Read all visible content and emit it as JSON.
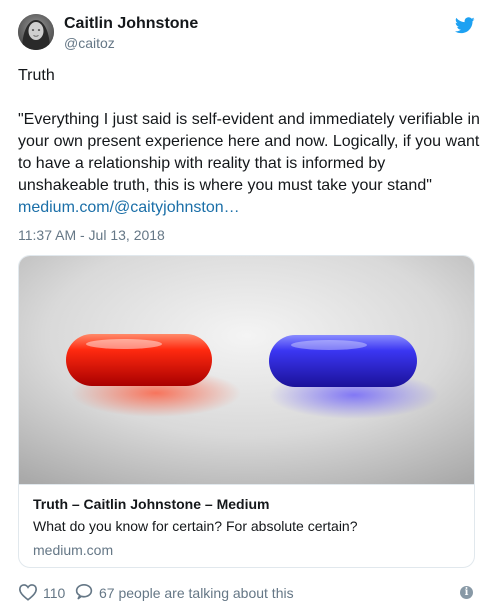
{
  "author": {
    "name": "Caitlin Johnstone",
    "handle": "@caitoz"
  },
  "tweet": {
    "text": "Truth\n\n\"Everything I just said is self-evident and immediately verifiable in your own present experience here and now. Logically, if you want to have a relationship with reality that is informed by unshakeable truth, this is where you must take your stand\"",
    "link": "medium.com/@caityjohnston…",
    "timestamp": "11:37 AM - Jul 13, 2018"
  },
  "card": {
    "title": "Truth – Caitlin Johnstone – Medium",
    "description": "What do you know for certain? For absolute certain?",
    "domain": "medium.com",
    "image_alt": "red pill and blue pill"
  },
  "actions": {
    "likes": "110",
    "talking": "67 people are talking about this"
  },
  "colors": {
    "link": "#1b6fa8",
    "twitter_blue": "#1da1f2",
    "muted": "#657786"
  },
  "icons": {
    "brand": "twitter-bird-icon",
    "like": "heart-icon",
    "reply": "speech-bubble-icon",
    "info": "info-icon"
  }
}
